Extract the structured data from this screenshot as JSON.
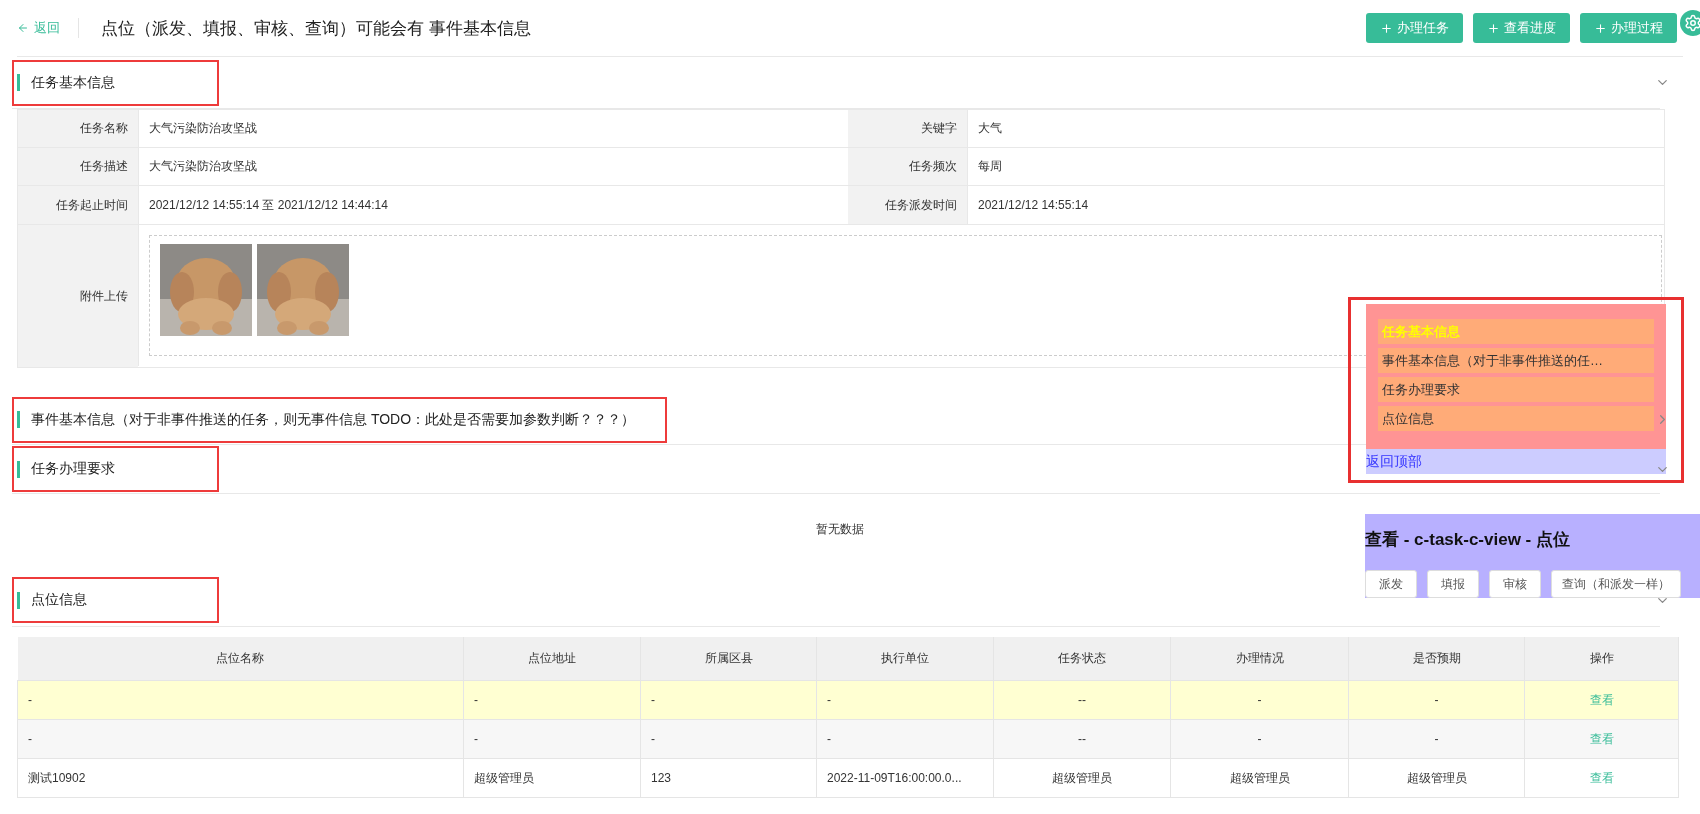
{
  "header": {
    "back": "返回",
    "title": "点位（派发、填报、审核、查询）可能会有 事件基本信息",
    "actions": [
      {
        "label": "办理任务"
      },
      {
        "label": "查看进度"
      },
      {
        "label": "办理过程"
      }
    ]
  },
  "sections": [
    {
      "kind": "form",
      "title": "任务基本信息",
      "expanded": true,
      "annotated": true,
      "rows": [
        {
          "cells": [
            {
              "label": "任务名称",
              "value": "大气污染防治攻坚战"
            },
            {
              "label": "关键字",
              "value": "大气"
            }
          ]
        },
        {
          "cells": [
            {
              "label": "任务描述",
              "value": "大气污染防治攻坚战"
            },
            {
              "label": "任务频次",
              "value": "每周"
            }
          ]
        },
        {
          "cells": [
            {
              "label": "任务起止时间",
              "value": "2021/12/12 14:55:14 至 2021/12/12 14:44:14"
            },
            {
              "label": "任务派发时间",
              "value": "2021/12/12 14:55:14"
            }
          ]
        }
      ],
      "attachment": {
        "label": "附件上传"
      }
    },
    {
      "kind": "plain",
      "title": "事件基本信息（对于非事件推送的任务，则无事件信息 TODO：此处是否需要加参数判断？？？）",
      "expanded": false,
      "annotated": true
    },
    {
      "kind": "empty",
      "title": "任务办理要求",
      "expanded": true,
      "annotated": true,
      "empty_text": "暂无数据"
    },
    {
      "kind": "table",
      "title": "点位信息",
      "expanded": true,
      "annotated": true,
      "columns": [
        {
          "label": "点位名称"
        },
        {
          "label": "点位地址"
        },
        {
          "label": "所属区县"
        },
        {
          "label": "执行单位"
        },
        {
          "label": "任务状态"
        },
        {
          "label": "办理情况"
        },
        {
          "label": "是否预期"
        },
        {
          "label": "操作"
        }
      ],
      "rows": [
        {
          "highlighted": true,
          "cells": [
            "-",
            "-",
            "-",
            "-",
            "--",
            "-",
            "-"
          ],
          "action": "查看"
        },
        {
          "highlighted": false,
          "cells": [
            "-",
            "-",
            "-",
            "-",
            "--",
            "-",
            "-"
          ],
          "action": "查看"
        },
        {
          "highlighted": false,
          "cells": [
            "测试10902",
            "超级管理员",
            "123",
            "2022-11-09T16:00:00.0...",
            "超级管理员",
            "超级管理员",
            "超级管理员"
          ],
          "action": "查看"
        }
      ]
    }
  ],
  "nav_panel": {
    "annotated": true,
    "items": [
      {
        "label": "任务基本信息",
        "selected": true
      },
      {
        "label": "事件基本信息（对于非事件推送的任…",
        "selected": false
      },
      {
        "label": "任务办理要求",
        "selected": false
      },
      {
        "label": "点位信息",
        "selected": false
      }
    ],
    "back_top": "返回顶部"
  },
  "view_panel": {
    "title": "查看 - c-task-c-view - 点位",
    "buttons": [
      {
        "label": "派发"
      },
      {
        "label": "填报"
      },
      {
        "label": "审核"
      },
      {
        "label": "查询（和派发一样）"
      }
    ]
  }
}
